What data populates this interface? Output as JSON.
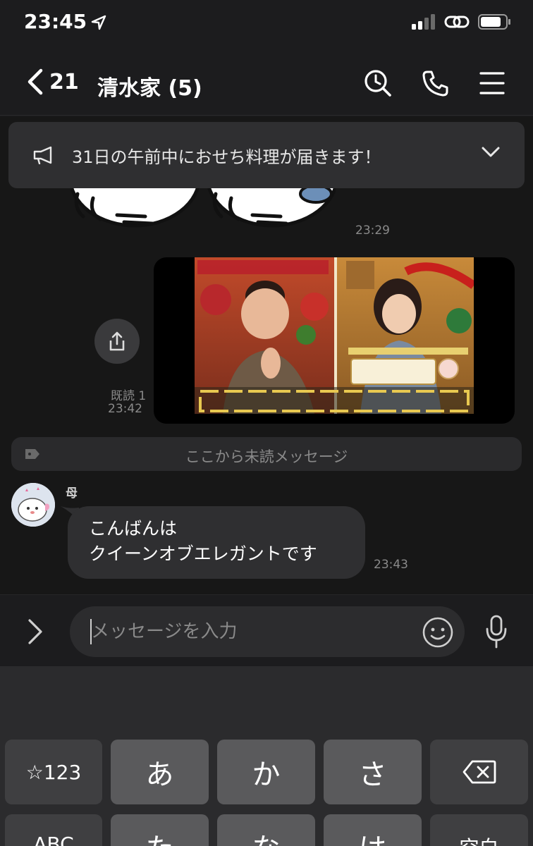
{
  "status_bar": {
    "time": "23:45"
  },
  "nav": {
    "back_count": "21",
    "title": "清水家 (5)"
  },
  "announcement": {
    "text": "31日の午前中におせち料理が届きます！"
  },
  "messages": {
    "sticker_time": "23:29",
    "video": {
      "read_label": "既読 1",
      "time": "23:42"
    },
    "unread_divider": "ここから未読メッセージ",
    "incoming": {
      "sender": "母",
      "lines": [
        "こんばんは",
        "クイーンオブエレガントです"
      ],
      "time": "23:43"
    }
  },
  "input": {
    "placeholder": "メッセージを入力"
  },
  "keyboard": {
    "row1": [
      "☆123",
      "あ",
      "か",
      "さ"
    ],
    "row2": [
      "ABC",
      "た",
      "な",
      "は",
      "空白"
    ]
  },
  "colors": {
    "background": "#171717",
    "bubble": "#2f2f31",
    "announce": "#2f2f31"
  }
}
